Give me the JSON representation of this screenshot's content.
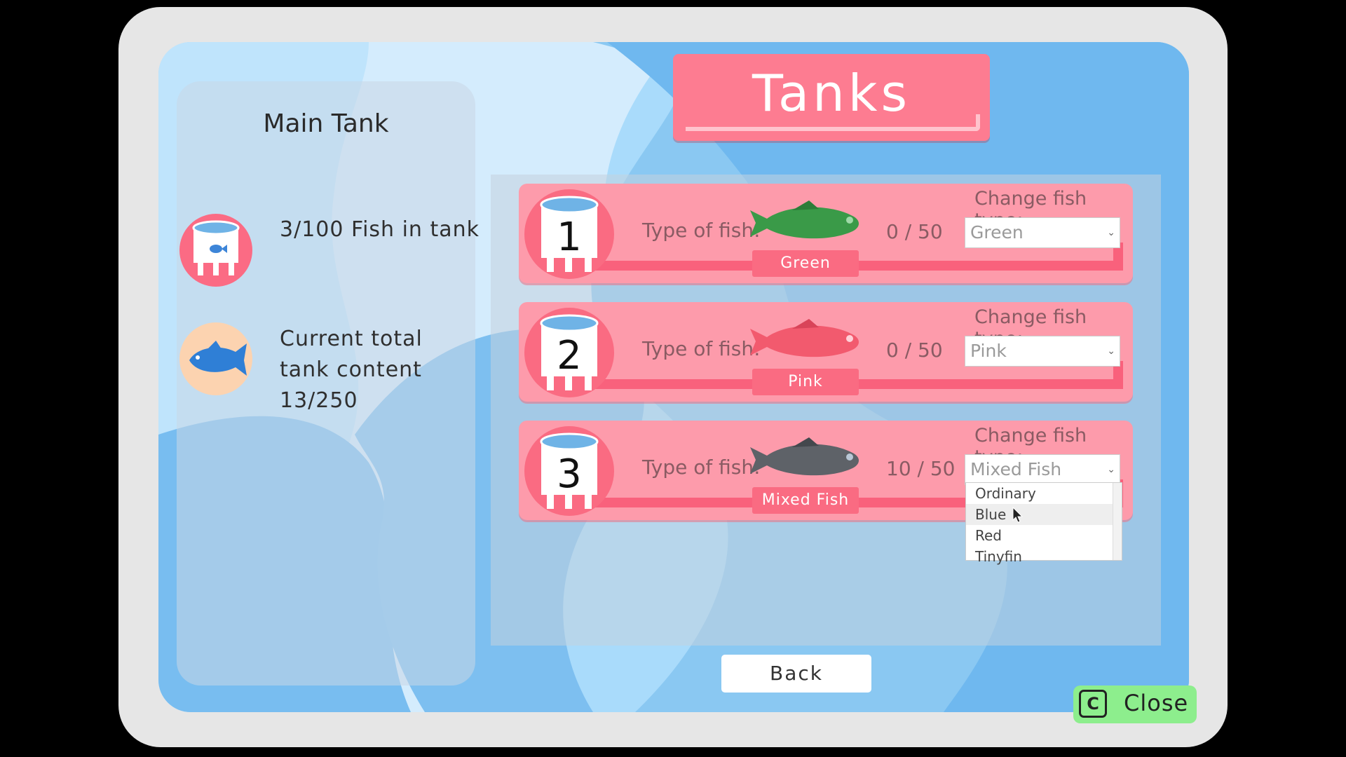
{
  "panel": {
    "title": "Main Tank",
    "stats": [
      {
        "text": "3/100 Fish in tank",
        "icon": "tank-icon"
      },
      {
        "line1": "Current total",
        "line2": "tank content",
        "line3": "13/250",
        "icon": "fish-icon"
      }
    ]
  },
  "header": {
    "title": "Tanks"
  },
  "rows": [
    {
      "number": "1",
      "type_label": "Type of fish:",
      "count": "0 / 50",
      "tag": "Green",
      "change_label": "Change fish type:",
      "selected": "Green",
      "fish_color": "#3a9a48",
      "fish_icon": "green-fish-icon"
    },
    {
      "number": "2",
      "type_label": "Type of fish:",
      "count": "0 / 50",
      "tag": "Pink",
      "change_label": "Change fish type:",
      "selected": "Pink",
      "fish_color": "#f25a6e",
      "fish_icon": "pink-fish-icon"
    },
    {
      "number": "3",
      "type_label": "Type of fish:",
      "count": "10 / 50",
      "tag": "Mixed Fish",
      "change_label": "Change fish type:",
      "selected": "Mixed Fish",
      "fish_color": "#5e6268",
      "fish_icon": "gray-fish-icon"
    }
  ],
  "dropdown": {
    "options": [
      "Ordinary",
      "Blue",
      "Red",
      "Tinyfin"
    ],
    "hovered": "Blue"
  },
  "buttons": {
    "back": "Back",
    "close": "Close",
    "close_key": "C"
  },
  "colors": {
    "accent": "#fd7c91",
    "row": "#fd9bab",
    "close_bg": "#8dee8d"
  }
}
